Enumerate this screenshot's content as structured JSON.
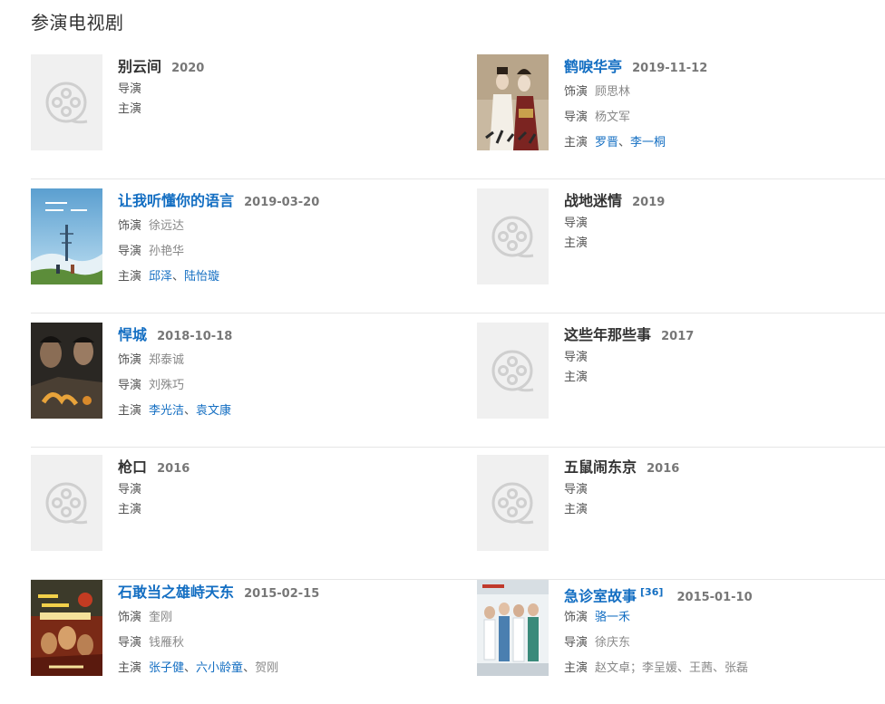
{
  "section_title": "参演电视剧",
  "labels": {
    "role": "饰演",
    "director": "导演",
    "cast": "主演"
  },
  "works": [
    {
      "title": "别云间",
      "year": "2020",
      "title_link": false,
      "has_poster": false,
      "director": "",
      "cast": []
    },
    {
      "title": "鹤唳华亭",
      "year": "2019-11-12",
      "title_link": true,
      "has_poster": true,
      "poster_icon": "costume-drama-poster",
      "role": "顾思林",
      "director": "杨文军",
      "cast": [
        {
          "name": "罗晋",
          "link": true
        },
        {
          "name": "李一桐",
          "link": true
        }
      ]
    },
    {
      "title": "让我听懂你的语言",
      "year": "2019-03-20",
      "title_link": true,
      "has_poster": true,
      "poster_icon": "landscape-poster",
      "role": "徐远达",
      "director": "孙艳华",
      "cast": [
        {
          "name": "邱泽",
          "link": true
        },
        {
          "name": "陆怡璇",
          "link": true
        }
      ]
    },
    {
      "title": "战地迷情",
      "year": "2019",
      "title_link": false,
      "has_poster": false,
      "director": "",
      "cast": []
    },
    {
      "title": "悍城",
      "year": "2018-10-18",
      "title_link": true,
      "has_poster": true,
      "poster_icon": "crime-drama-poster",
      "role": "郑泰诚",
      "director": "刘殊巧",
      "cast": [
        {
          "name": "李光洁",
          "link": true
        },
        {
          "name": "袁文康",
          "link": true
        }
      ]
    },
    {
      "title": "这些年那些事",
      "year": "2017",
      "title_link": false,
      "has_poster": false,
      "director": "",
      "cast": []
    },
    {
      "title": "枪口",
      "year": "2016",
      "title_link": false,
      "has_poster": false,
      "director": "",
      "cast": []
    },
    {
      "title": "五鼠闹东京",
      "year": "2016",
      "title_link": false,
      "has_poster": false,
      "director": "",
      "cast": []
    },
    {
      "title": "石敢当之雄峙天东",
      "year": "2015-02-15",
      "title_link": true,
      "has_poster": true,
      "poster_icon": "fantasy-drama-poster",
      "role": "奎刚",
      "role_link": false,
      "director": "钱雁秋",
      "cast": [
        {
          "name": "张子健",
          "link": true
        },
        {
          "name": "六小龄童",
          "link": true
        },
        {
          "name": "贺刚",
          "link": false
        }
      ]
    },
    {
      "title": "急诊室故事",
      "ref": "[36]",
      "year": "2015-01-10",
      "title_link": true,
      "has_poster": true,
      "poster_icon": "hospital-drama-poster",
      "role": "骆一禾",
      "role_link": true,
      "director": "徐庆东",
      "cast_text": "赵文卓；李呈媛、王茜、张磊"
    }
  ],
  "colors": {
    "link": "#136ec2",
    "placeholder_bg": "#f0f0f0",
    "divider": "#e6e6e6"
  }
}
